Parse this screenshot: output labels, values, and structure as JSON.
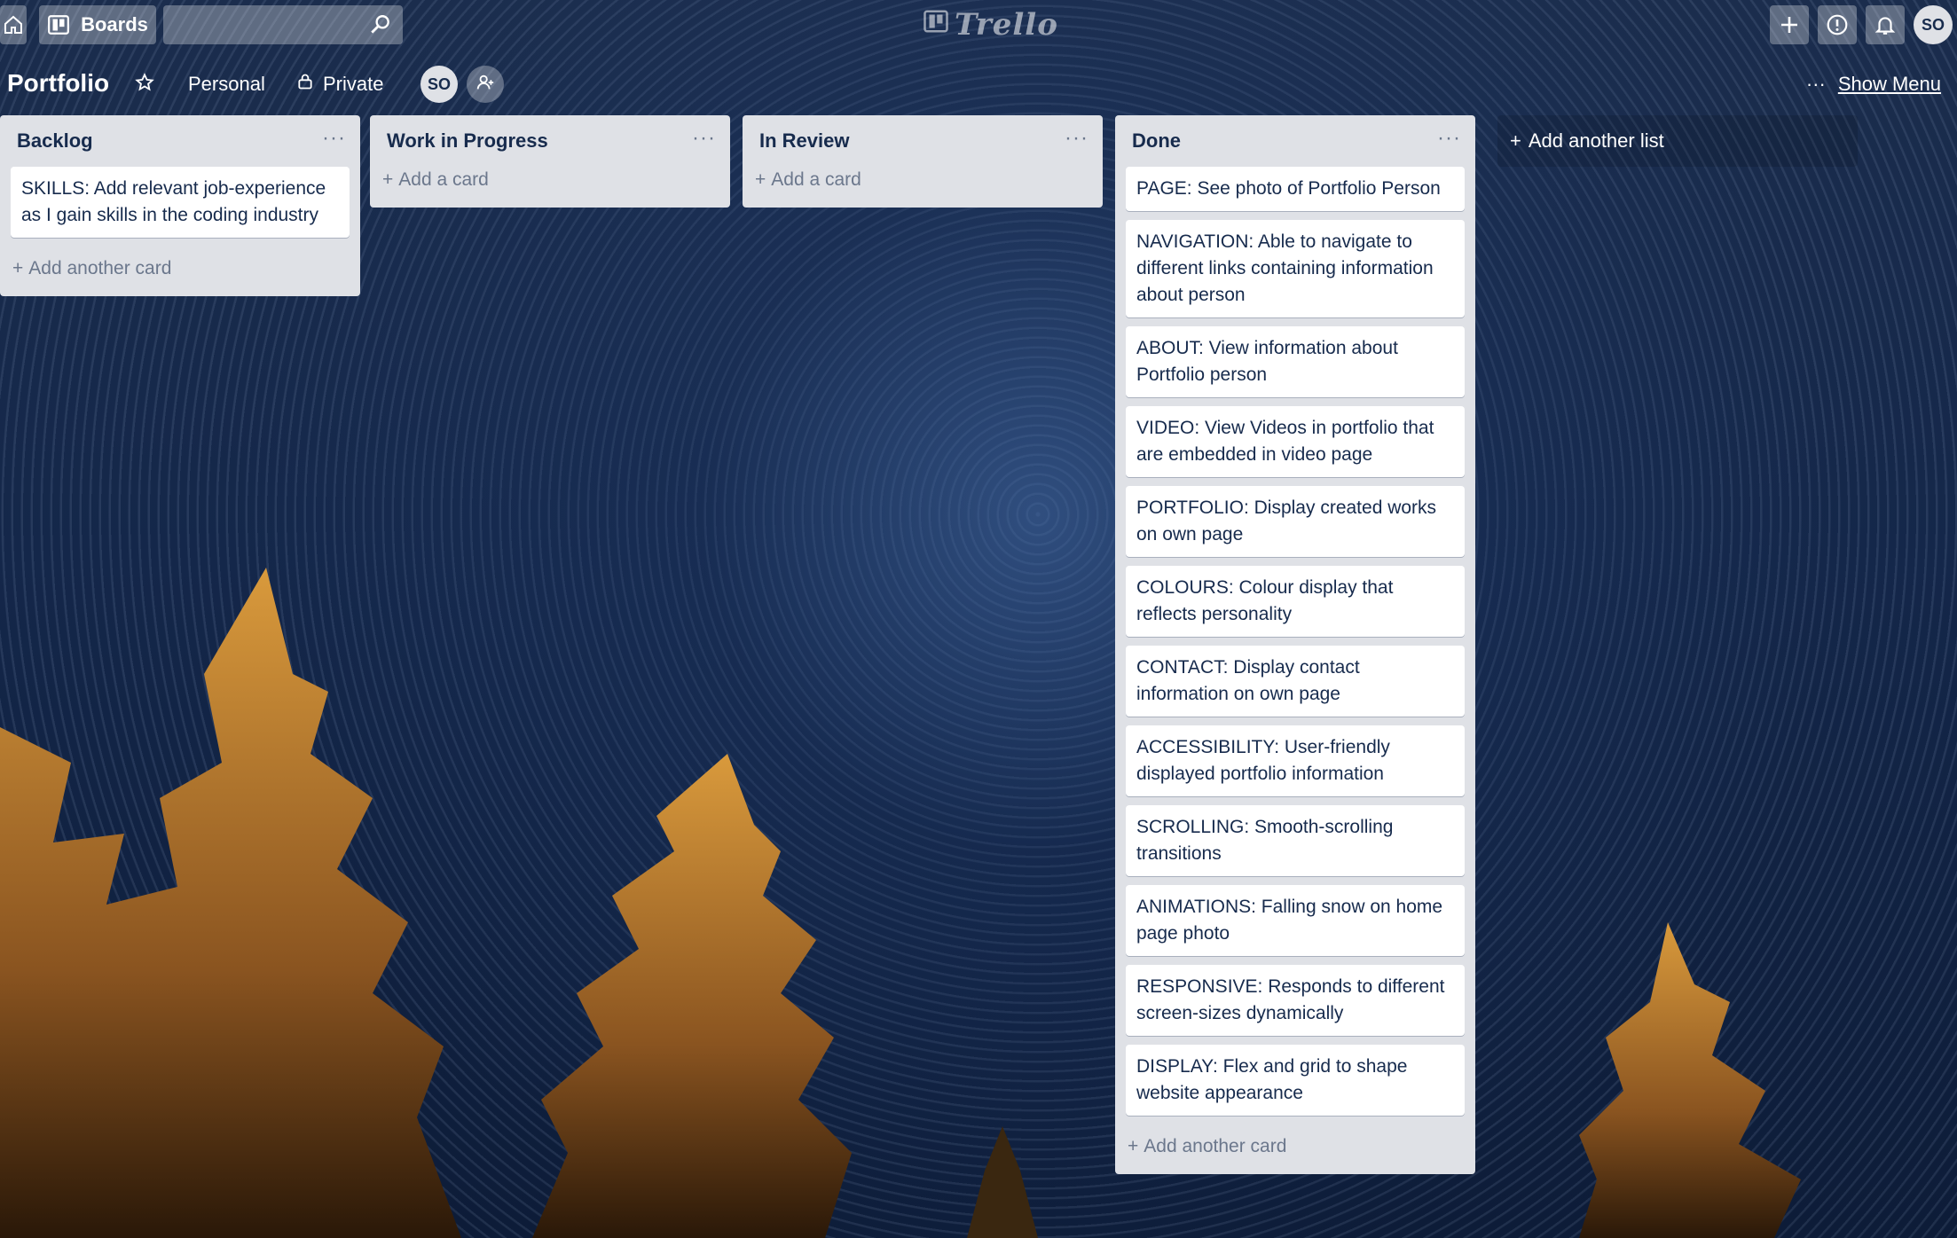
{
  "topbar": {
    "boards_label": "Boards",
    "search_value": "",
    "logo_text": "Trello",
    "user_initials": "SO"
  },
  "board": {
    "title": "Portfolio",
    "team_label": "Personal",
    "visibility_label": "Private",
    "member_initials": "SO",
    "show_menu_label": "Show Menu"
  },
  "lists": [
    {
      "title": "Backlog",
      "cards": [
        "SKILLS: Add relevant job-experience as I gain skills in the coding industry"
      ],
      "add_label": "Add another card"
    },
    {
      "title": "Work in Progress",
      "cards": [],
      "add_label": "Add a card"
    },
    {
      "title": "In Review",
      "cards": [],
      "add_label": "Add a card"
    },
    {
      "title": "Done",
      "cards": [
        "PAGE: See photo of Portfolio Person",
        "NAVIGATION: Able to navigate to different links containing information about person",
        "ABOUT: View information about Portfolio person",
        "VIDEO: View Videos in portfolio that are embedded in video page",
        "PORTFOLIO: Display created works on own page",
        "COLOURS: Colour display that reflects personality",
        "CONTACT: Display contact information on own page",
        "ACCESSIBILITY: User-friendly displayed portfolio information",
        "SCROLLING: Smooth-scrolling transitions",
        "ANIMATIONS: Falling snow on home page photo",
        "RESPONSIVE: Responds to different screen-sizes dynamically",
        "DISPLAY: Flex and grid to shape website appearance"
      ],
      "add_label": "Add another card"
    }
  ],
  "add_list_label": "Add another list",
  "colors": {
    "list_bg": "#dfe1e6",
    "card_text": "#172b4d",
    "muted_text": "#6b778c",
    "sky": "#14274a",
    "tree_glow": "#c9822a"
  }
}
